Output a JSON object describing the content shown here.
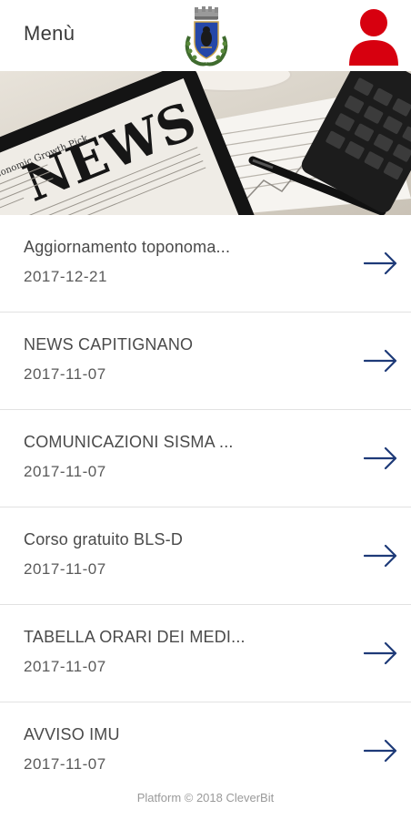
{
  "header": {
    "menu_label": "Menù",
    "crest_icon": "municipal-crest-icon",
    "user_icon": "user-profile-icon",
    "user_icon_color": "#d7000f"
  },
  "banner": {
    "image": "news-newspaper-banner",
    "newspaper_headline": "NEWS",
    "newspaper_subline": "Economic Growth Pick"
  },
  "news": [
    {
      "title": "Aggiornamento toponoma...",
      "date": "2017-12-21"
    },
    {
      "title": "NEWS CAPITIGNANO",
      "date": "2017-11-07"
    },
    {
      "title": "COMUNICAZIONI SISMA ...",
      "date": "2017-11-07"
    },
    {
      "title": "Corso gratuito BLS-D",
      "date": "2017-11-07"
    },
    {
      "title": "TABELLA ORARI DEI MEDI...",
      "date": "2017-11-07"
    },
    {
      "title": "AVVISO IMU",
      "date": "2017-11-07"
    }
  ],
  "arrow_icon": "arrow-right-icon",
  "arrow_color": "#1e3a78",
  "footer": {
    "text": "Platform © 2018 CleverBit"
  }
}
